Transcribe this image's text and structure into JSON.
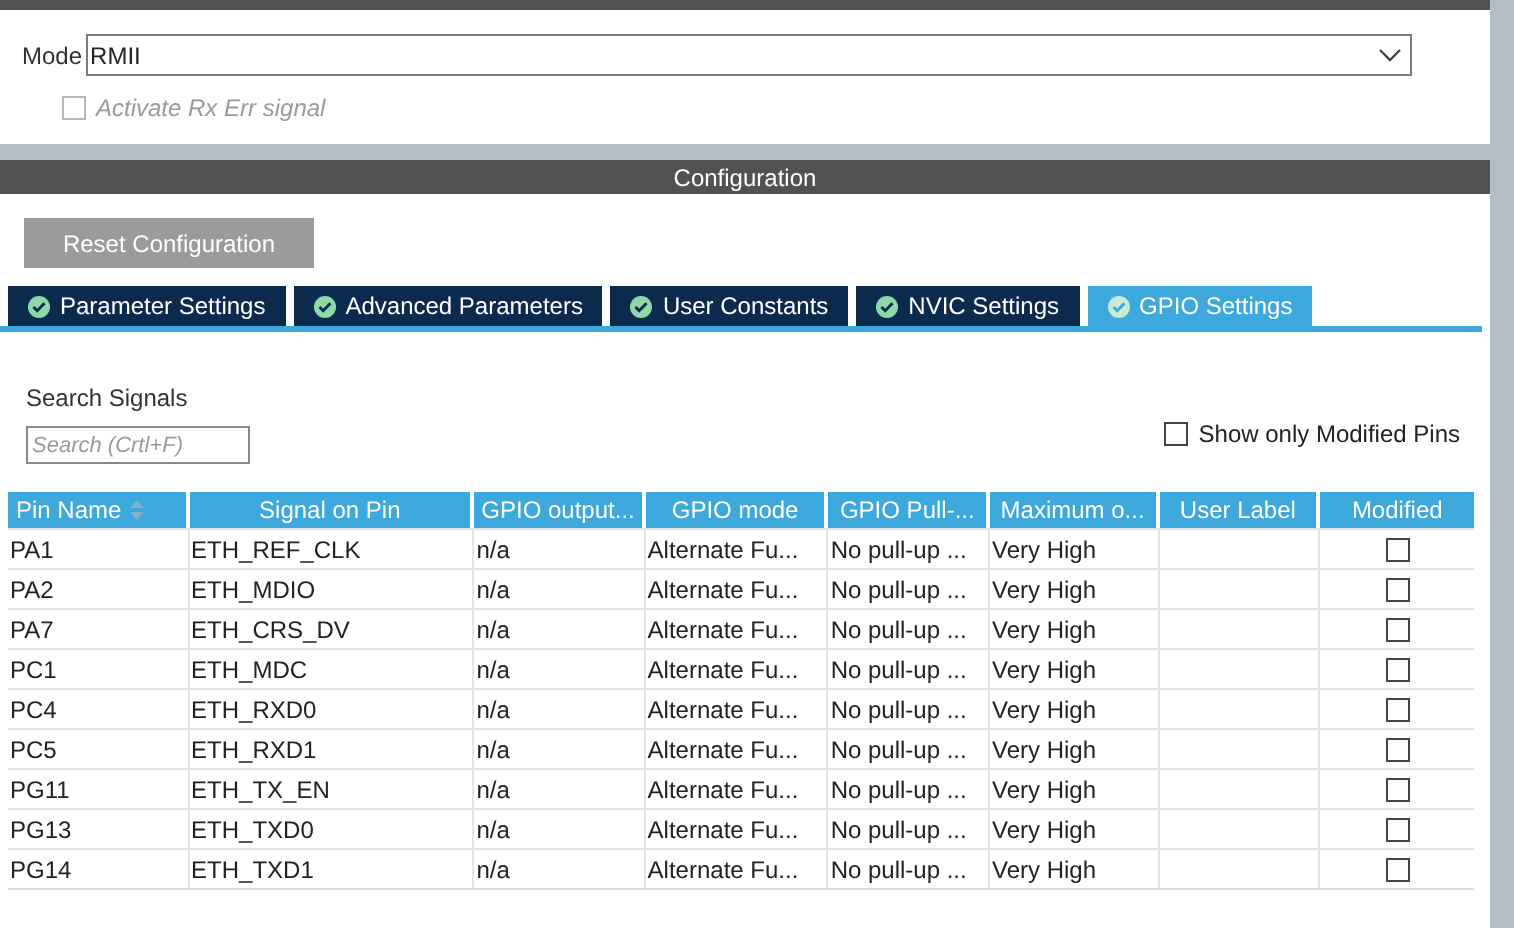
{
  "mode": {
    "label": "Mode",
    "value": "RMII",
    "rx_err": {
      "label": "Activate Rx Err signal",
      "checked": false,
      "disabled": true
    }
  },
  "configuration": {
    "title": "Configuration",
    "reset_button": "Reset Configuration",
    "tabs": [
      {
        "label": "Parameter Settings",
        "selected": false
      },
      {
        "label": "Advanced Parameters",
        "selected": false
      },
      {
        "label": "User Constants",
        "selected": false
      },
      {
        "label": "NVIC Settings",
        "selected": false
      },
      {
        "label": "GPIO Settings",
        "selected": true
      }
    ],
    "search": {
      "label": "Search Signals",
      "placeholder": "Search (Crtl+F)"
    },
    "show_modified": {
      "label": "Show only Modified Pins",
      "checked": false
    },
    "table": {
      "columns": [
        "Pin Name",
        "Signal on Pin",
        "GPIO output...",
        "GPIO mode",
        "GPIO Pull-...",
        "Maximum o...",
        "User Label",
        "Modified"
      ],
      "rows": [
        {
          "pin": "PA1",
          "signal": "ETH_REF_CLK",
          "output": "n/a",
          "mode": "Alternate Fu...",
          "pull": "No pull-up ...",
          "speed": "Very High",
          "modified": false
        },
        {
          "pin": "PA2",
          "signal": "ETH_MDIO",
          "output": "n/a",
          "mode": "Alternate Fu...",
          "pull": "No pull-up ...",
          "speed": "Very High",
          "modified": false
        },
        {
          "pin": "PA7",
          "signal": "ETH_CRS_DV",
          "output": "n/a",
          "mode": "Alternate Fu...",
          "pull": "No pull-up ...",
          "speed": "Very High",
          "modified": false
        },
        {
          "pin": "PC1",
          "signal": "ETH_MDC",
          "output": "n/a",
          "mode": "Alternate Fu...",
          "pull": "No pull-up ...",
          "speed": "Very High",
          "modified": false
        },
        {
          "pin": "PC4",
          "signal": "ETH_RXD0",
          "output": "n/a",
          "mode": "Alternate Fu...",
          "pull": "No pull-up ...",
          "speed": "Very High",
          "modified": false
        },
        {
          "pin": "PC5",
          "signal": "ETH_RXD1",
          "output": "n/a",
          "mode": "Alternate Fu...",
          "pull": "No pull-up ...",
          "speed": "Very High",
          "modified": false
        },
        {
          "pin": "PG11",
          "signal": "ETH_TX_EN",
          "output": "n/a",
          "mode": "Alternate Fu...",
          "pull": "No pull-up ...",
          "speed": "Very High",
          "modified": false
        },
        {
          "pin": "PG13",
          "signal": "ETH_TXD0",
          "output": "n/a",
          "mode": "Alternate Fu...",
          "pull": "No pull-up ...",
          "speed": "Very High",
          "modified": false
        },
        {
          "pin": "PG14",
          "signal": "ETH_TXD1",
          "output": "n/a",
          "mode": "Alternate Fu...",
          "pull": "No pull-up ...",
          "speed": "Very High",
          "modified": false
        }
      ]
    }
  }
}
